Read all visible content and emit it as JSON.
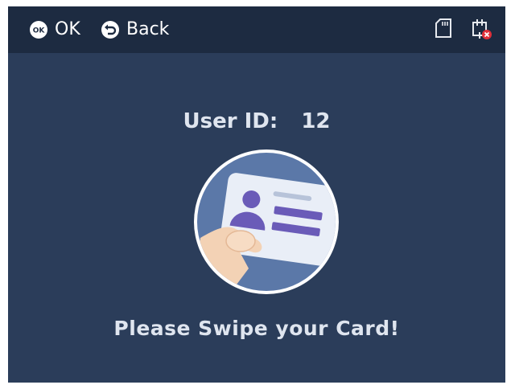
{
  "header": {
    "ok_label": "OK",
    "back_label": "Back",
    "ok_icon": "ok-button-icon",
    "back_icon": "back-arrow-icon",
    "status_icons": [
      "sd-card-icon",
      "network-disconnected-icon"
    ]
  },
  "main": {
    "user_id_label": "User ID:",
    "user_id_value": "12",
    "illustration_icon": "swipe-card-icon",
    "prompt": "Please Swipe your Card!"
  },
  "colors": {
    "background": "#2b3d5a",
    "header_bg": "#1d2b41",
    "text": "#dfe5ef",
    "accent_purple": "#6a5bb8",
    "error_red": "#e0303a"
  }
}
